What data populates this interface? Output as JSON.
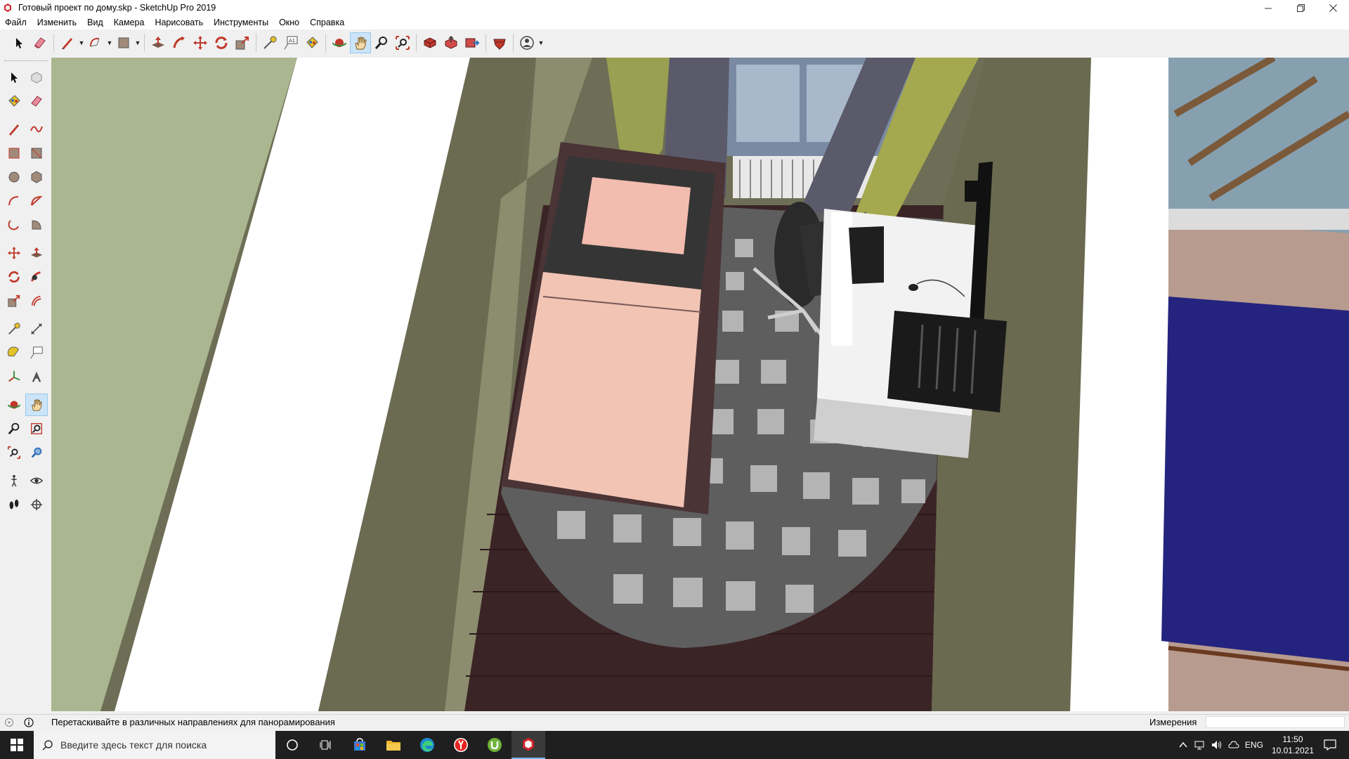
{
  "window": {
    "title": "Готовый проект по дому.skp - SketchUp Pro 2019",
    "minimize_icon": "minimize-icon",
    "maximize_icon": "restore-icon",
    "close_icon": "close-icon"
  },
  "menu": {
    "items": [
      "Файл",
      "Изменить",
      "Вид",
      "Камера",
      "Нарисовать",
      "Инструменты",
      "Окно",
      "Справка"
    ]
  },
  "toolbar": {
    "tools": [
      "select",
      "eraser",
      "line",
      "arc",
      "shape",
      "push-pull",
      "follow-me",
      "move",
      "rotate",
      "scale",
      "tape-measure",
      "text",
      "paint-bucket",
      "orbit",
      "pan",
      "zoom",
      "zoom-extents",
      "3d-warehouse",
      "extension-warehouse",
      "layout",
      "extension-manager",
      "profile"
    ],
    "active_tool": "pan"
  },
  "palette": {
    "active_tool": "pan"
  },
  "status": {
    "hint": "Перетаскивайте в различных направлениях для панорамирования",
    "measurements_label": "Измерения",
    "measurements_value": ""
  },
  "taskbar": {
    "search_placeholder": "Введите здесь текст для поиска",
    "language": "ENG",
    "time": "11:50",
    "date": "10.01.2021"
  },
  "colors": {
    "accent": "#cce4f7",
    "taskbar": "#1f1f1f"
  }
}
